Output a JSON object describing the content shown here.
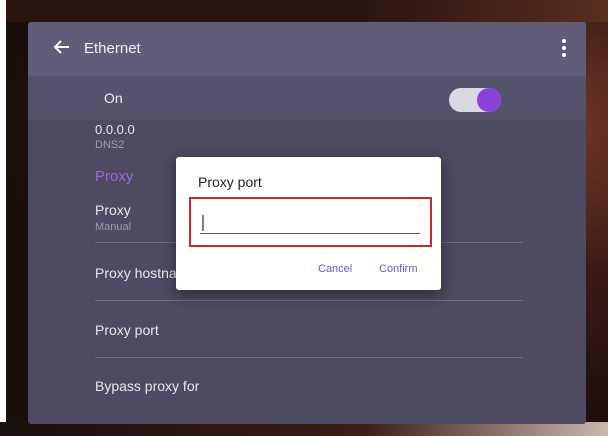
{
  "topbar": {
    "title": "Ethernet",
    "back_icon": "arrow-left-icon",
    "more_icon": "more-vertical-icon"
  },
  "on_row": {
    "label": "On",
    "toggle_state": "on",
    "accent": "#8a42d8"
  },
  "list": {
    "dns2_value": "0.0.0.0",
    "dns2_label": "DNS2",
    "proxy_section": "Proxy",
    "proxy_item": {
      "label": "Proxy",
      "value": "Manual"
    },
    "proxy_hostname": "Proxy hostname",
    "proxy_port": "Proxy port",
    "bypass_proxy": "Bypass proxy for"
  },
  "dialog": {
    "title": "Proxy port",
    "input_value": "",
    "cancel_label": "Cancel",
    "confirm_label": "Confirm",
    "highlight_color": "#c8292b"
  }
}
